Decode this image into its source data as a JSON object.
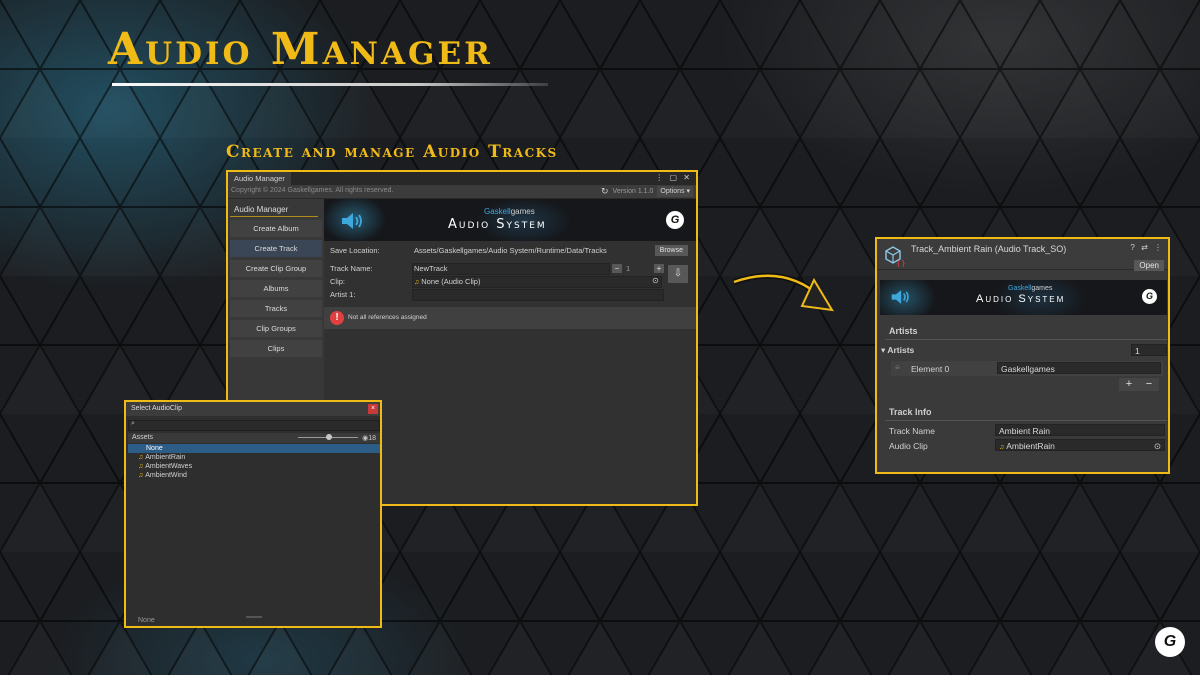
{
  "hero": {
    "title": "Audio Manager",
    "subtitle": "Create and manage Audio Tracks"
  },
  "colors": {
    "accent": "#f1bb17",
    "selection": "#2c5d87",
    "warning": "#e04040",
    "brand_blue": "#3ea7dc"
  },
  "audio_manager_window": {
    "tab_title": "Audio Manager",
    "window_controls": "⋮ ▢ ✕",
    "copyright": "Copyright © 2024 Gaskellgames. All rights reserved.",
    "version": "Version 1.1.0",
    "options_label": "Options ▾",
    "sidebar": {
      "header": "Audio Manager",
      "items": [
        {
          "label": "Create Album"
        },
        {
          "label": "Create Track"
        },
        {
          "label": "Create Clip Group"
        },
        {
          "label": "Albums"
        },
        {
          "label": "Tracks"
        },
        {
          "label": "Clip Groups"
        },
        {
          "label": "Clips"
        }
      ],
      "active": "Create Track"
    },
    "banner": {
      "brand_prefix": "Gaskell",
      "brand_suffix": "games",
      "title": "Audio System",
      "logo": "G"
    },
    "save_location": {
      "label": "Save Location:",
      "value": "Assets/Gaskellgames/Audio System/Runtime/Data/Tracks",
      "browse_label": "Browse"
    },
    "track_name": {
      "label": "Track Name:",
      "value": "NewTrack",
      "count": "1"
    },
    "clip": {
      "label": "Clip:",
      "value": "None (Audio Clip)"
    },
    "artist": {
      "label": "Artist 1:"
    },
    "warning": "Not all references assigned"
  },
  "select_audioclip": {
    "title": "Select AudioClip",
    "assets_label": "Assets",
    "count": "18",
    "items": [
      {
        "label": "None",
        "selected": true
      },
      {
        "label": "AmbientRain",
        "selected": false
      },
      {
        "label": "AmbientWaves",
        "selected": false
      },
      {
        "label": "AmbientWind",
        "selected": false
      }
    ],
    "footer": "None"
  },
  "inspector": {
    "title": "Track_Ambient Rain (Audio Track_SO)",
    "header_icons": "? ⇄ ⋮",
    "open_label": "Open",
    "banner": {
      "brand_prefix": "Gaskell",
      "brand_suffix": "games",
      "title": "Audio System",
      "logo": "G"
    },
    "artists_section": "Artists",
    "artists_list_label": "Artists",
    "artists_count": "1",
    "element_label": "Element 0",
    "element_value": "Gaskellgames",
    "plus": "+",
    "minus": "−",
    "track_info_section": "Track Info",
    "track_name_label": "Track Name",
    "track_name_value": "Ambient Rain",
    "audio_clip_label": "Audio Clip",
    "audio_clip_value": "AmbientRain"
  },
  "corner_logo": "G"
}
